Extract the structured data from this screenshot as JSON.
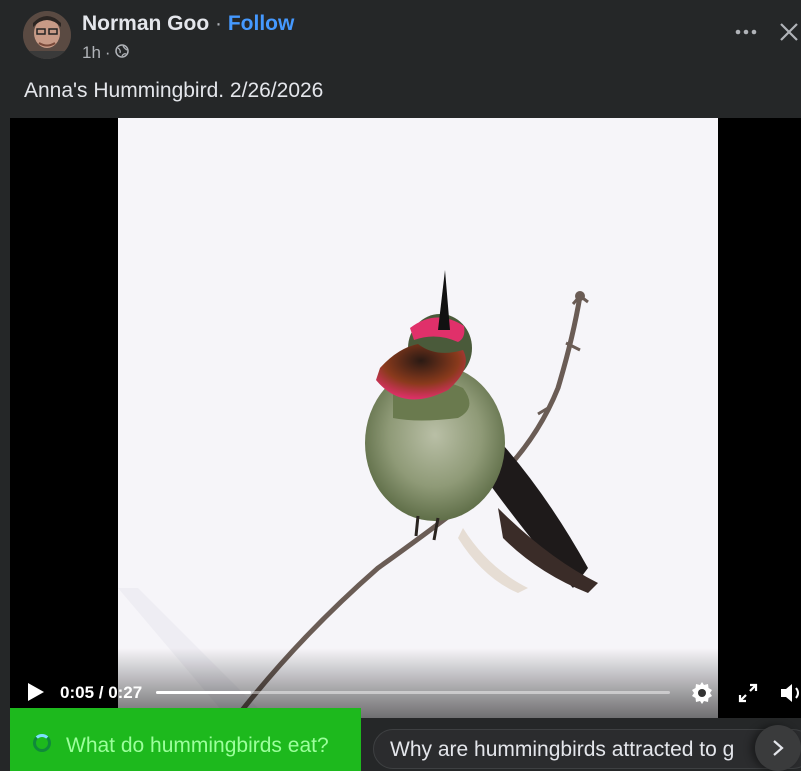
{
  "post": {
    "author": "Norman Goo",
    "separator": "·",
    "follow_label": "Follow",
    "timestamp": "1h",
    "privacy_separator": "·",
    "privacy_icon": "globe-icon",
    "caption": "Anna's Hummingbird. 2/26/2026"
  },
  "video": {
    "current_time": "0:05",
    "duration": "0:27",
    "time_display": "0:05 / 0:27",
    "progress": 0.185
  },
  "suggestions": [
    {
      "label": "What do hummingbirds eat?"
    },
    {
      "label": "Why are hummingbirds attracted to g"
    }
  ],
  "colors": {
    "follow": "#4599ff",
    "background": "#252728",
    "highlight": "#1db91d"
  }
}
